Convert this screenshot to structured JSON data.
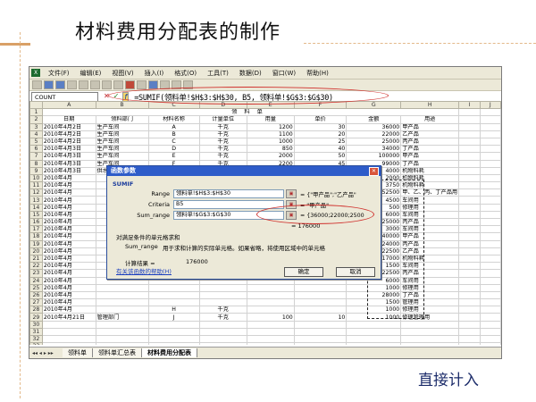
{
  "slide": {
    "title": "材料费用分配表的制作",
    "bottom_note": "直接计入"
  },
  "excel": {
    "menu": [
      "文件(F)",
      "编辑(E)",
      "视图(V)",
      "插入(I)",
      "格式(O)",
      "工具(T)",
      "数据(D)",
      "窗口(W)",
      "帮助(H)"
    ],
    "name_box": "COUNT",
    "formula": "=SUMIF(领料单!$H$3:$H$30, B5, 领料单!$G$3:$G$30)",
    "col_headers": [
      "A",
      "B",
      "C",
      "D",
      "E",
      "F",
      "G",
      "H",
      "I",
      "J"
    ],
    "sheet_title": "领料单",
    "table_headers": [
      "日期",
      "领料部门",
      "材料名称",
      "计量单位",
      "用量",
      "单价",
      "金额",
      "用途"
    ],
    "rows": [
      [
        "2010年4月2日",
        "生产车间",
        "A",
        "千克",
        "1200",
        "30",
        "36000",
        "甲产品"
      ],
      [
        "2010年4月2日",
        "生产车间",
        "B",
        "千克",
        "1100",
        "20",
        "22000",
        "乙产品"
      ],
      [
        "2010年4月2日",
        "生产车间",
        "C",
        "千克",
        "1000",
        "25",
        "25000",
        "丙产品"
      ],
      [
        "2010年4月3日",
        "生产车间",
        "D",
        "千克",
        "850",
        "40",
        "34000",
        "丁产品"
      ],
      [
        "2010年4月3日",
        "生产车间",
        "E",
        "千克",
        "2000",
        "50",
        "100000",
        "甲产品"
      ],
      [
        "2010年4月3日",
        "生产车间",
        "F",
        "千克",
        "2200",
        "45",
        "99000",
        "丁产品"
      ],
      [
        "2010年4月3日",
        "供水车间",
        "G",
        "千克",
        "200",
        "20",
        "4000",
        "机物料耗"
      ],
      [
        "2010年4月",
        "",
        "",
        "",
        "",
        "",
        "2000",
        "机物料耗"
      ],
      [
        "2010年4月",
        "",
        "",
        "",
        "",
        "",
        "3750",
        "机物料耗"
      ],
      [
        "2010年4月",
        "",
        "",
        "",
        "",
        "",
        "52500",
        "甲、乙、丙、丁产品用"
      ],
      [
        "2010年4月",
        "",
        "",
        "",
        "",
        "",
        "4500",
        "车间用"
      ],
      [
        "2010年4月",
        "",
        "",
        "",
        "",
        "",
        "500",
        "修理用"
      ],
      [
        "2010年4月",
        "",
        "",
        "",
        "",
        "",
        "6000",
        "车间用"
      ],
      [
        "2010年4月",
        "",
        "",
        "",
        "",
        "",
        "25000",
        "丙产品"
      ],
      [
        "2010年4月",
        "",
        "",
        "",
        "",
        "",
        "3000",
        "车间用"
      ],
      [
        "2010年4月",
        "",
        "",
        "",
        "",
        "",
        "40000",
        "甲产品"
      ],
      [
        "2010年4月",
        "",
        "",
        "",
        "",
        "",
        "24000",
        "丙产品"
      ],
      [
        "2010年4月",
        "",
        "",
        "",
        "",
        "",
        "22500",
        "乙产品"
      ],
      [
        "2010年4月",
        "",
        "",
        "",
        "",
        "",
        "17000",
        "机物料耗"
      ],
      [
        "2010年4月",
        "",
        "",
        "",
        "",
        "",
        "1500",
        "车间用"
      ],
      [
        "2010年4月",
        "",
        "",
        "",
        "",
        "",
        "22500",
        "丙产品"
      ],
      [
        "2010年4月",
        "",
        "",
        "",
        "",
        "",
        "6000",
        "车间用"
      ],
      [
        "2010年4月",
        "",
        "",
        "",
        "",
        "",
        "1000",
        "修理用"
      ],
      [
        "2010年4月",
        "",
        "",
        "",
        "",
        "",
        "28000",
        "丁产品"
      ],
      [
        "2010年4月",
        "",
        "",
        "",
        "",
        "",
        "1500",
        "管理用"
      ],
      [
        "2010年4月",
        "",
        "H",
        "千克",
        "",
        "",
        "1000",
        "修理用"
      ],
      [
        "2010年4月21日",
        "管理部门",
        "J",
        "千克",
        "100",
        "10",
        "1000",
        "修理管理用"
      ]
    ],
    "row_numbers": [
      "1",
      "2",
      "3",
      "4",
      "5",
      "6",
      "7",
      "8",
      "9",
      "10",
      "11",
      "12",
      "13",
      "14",
      "15",
      "16",
      "17",
      "18",
      "19",
      "20",
      "21",
      "22",
      "23",
      "24",
      "25",
      "26",
      "27",
      "28",
      "29",
      "30",
      "31",
      "32",
      "33",
      "34",
      "35",
      "36",
      "37"
    ],
    "tabs": [
      "领料单",
      "领料单汇总表",
      "材料费用分配表"
    ]
  },
  "dialog": {
    "title": "函数参数",
    "func": "SUMIF",
    "args": [
      {
        "label": "Range",
        "value": "领料单!$H$3:$H$30",
        "result": "= {\"甲产品\";\"乙产品\""
      },
      {
        "label": "Criteria",
        "value": "B5",
        "result": "= \"甲产品\""
      },
      {
        "label": "Sum_range",
        "value": "领料单!$G$3:$G$30",
        "result": "= {36000;22000;2500"
      }
    ],
    "total": "= 176000",
    "desc": "对满足条件的单元格求和",
    "param_desc_label": "Sum_range",
    "param_desc": "用于求和计算的实际单元格。如果省略，将使用区域中的单元格",
    "calc_label": "计算结果 =",
    "calc_value": "176000",
    "help_link": "有关该函数的帮助(H)",
    "ok": "确定",
    "cancel": "取消"
  }
}
